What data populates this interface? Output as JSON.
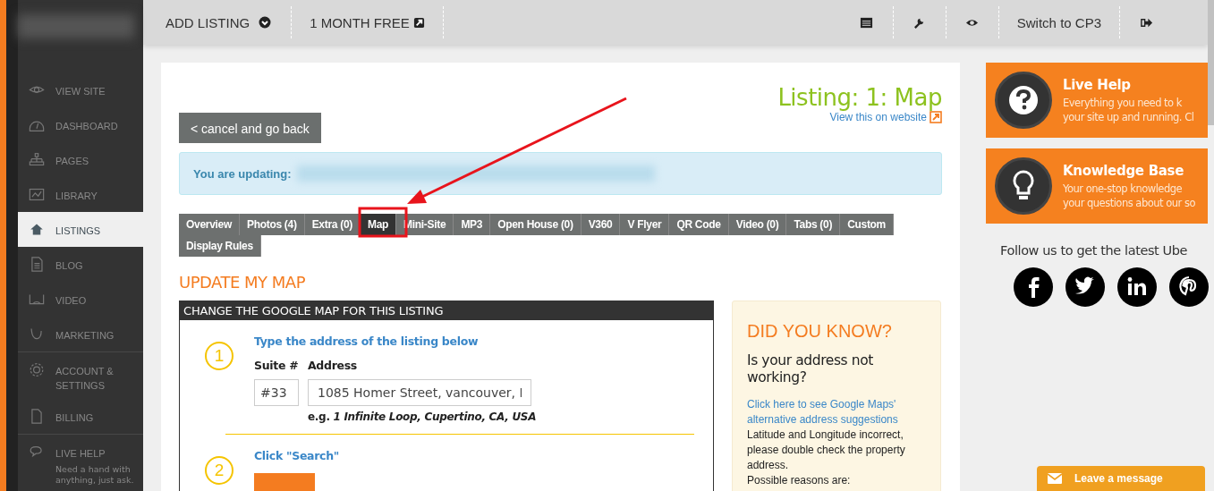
{
  "sidebar": {
    "items": [
      {
        "label": "VIEW SITE",
        "selected": false
      },
      {
        "label": "DASHBOARD",
        "selected": false
      },
      {
        "label": "PAGES",
        "selected": false
      },
      {
        "label": "LIBRARY",
        "selected": false
      },
      {
        "label": "LISTINGS",
        "selected": true
      },
      {
        "label": "BLOG",
        "selected": false
      },
      {
        "label": "VIDEO",
        "selected": false
      },
      {
        "label": "MARKETING",
        "selected": false
      },
      {
        "label": "ACCOUNT & SETTINGS",
        "selected": false
      },
      {
        "label": "BILLING",
        "selected": false
      },
      {
        "label": "LIVE HELP",
        "selected": false,
        "note": "Need a hand with anything, just ask."
      }
    ]
  },
  "topbar": {
    "left": [
      {
        "label": "ADD LISTING"
      },
      {
        "label": "1 MONTH FREE"
      }
    ],
    "right": [
      {
        "kind": "icon"
      },
      {
        "kind": "icon"
      },
      {
        "kind": "icon"
      },
      {
        "kind": "text",
        "label": "Switch to CP3"
      },
      {
        "kind": "icon"
      }
    ]
  },
  "page": {
    "title": "Listing: 1: Map",
    "view_link": "View this on website",
    "cancel_button": "< cancel and go back",
    "updating_label": "You are updating:",
    "tabs": [
      {
        "label": "Overview",
        "selected": false
      },
      {
        "label": "Photos (4)",
        "selected": false
      },
      {
        "label": "Extra (0)",
        "selected": false
      },
      {
        "label": "Map",
        "selected": true
      },
      {
        "label": "Mini-Site",
        "selected": false
      },
      {
        "label": "MP3",
        "selected": false
      },
      {
        "label": "Open House (0)",
        "selected": false
      },
      {
        "label": "V360",
        "selected": false
      },
      {
        "label": "V Flyer",
        "selected": false
      },
      {
        "label": "QR Code",
        "selected": false
      },
      {
        "label": "Video (0)",
        "selected": false
      },
      {
        "label": "Tabs (0)",
        "selected": false
      },
      {
        "label": "Custom",
        "selected": false
      },
      {
        "label": "Display Rules",
        "selected": false
      }
    ],
    "section_title": "UPDATE MY MAP",
    "map_box": {
      "header": "CHANGE THE GOOGLE MAP FOR THIS LISTING",
      "steps": [
        {
          "number": "1",
          "title": "Type the address of the listing below"
        },
        {
          "number": "2",
          "title": "Click \"Search\""
        }
      ],
      "suite_label": "Suite #",
      "suite_value": "#33",
      "address_label": "Address",
      "address_value": "1085 Homer Street, vancouver, I",
      "example": "e.g. *1 Infinite Loop, Cupertino, CA, USA*"
    },
    "tip_box": {
      "title": "DID YOU KNOW?",
      "question": "Is your address not working?",
      "link": "Click here to see Google Maps' alternative address suggestions",
      "text": "Latitude and Longitude incorrect, please double check the property address.",
      "cut_line": "Possible reasons are:"
    }
  },
  "right": {
    "cards": [
      {
        "title": "Live Help",
        "lines": [
          "Everything you need to k",
          "your site up and running. Cl"
        ]
      },
      {
        "title": "Knowledge Base",
        "lines": [
          "Your one-stop knowledge",
          "your questions about our so"
        ]
      }
    ],
    "follow": "Follow us to get the latest Ube"
  },
  "chat_widget": {
    "label": "Leave a message"
  }
}
